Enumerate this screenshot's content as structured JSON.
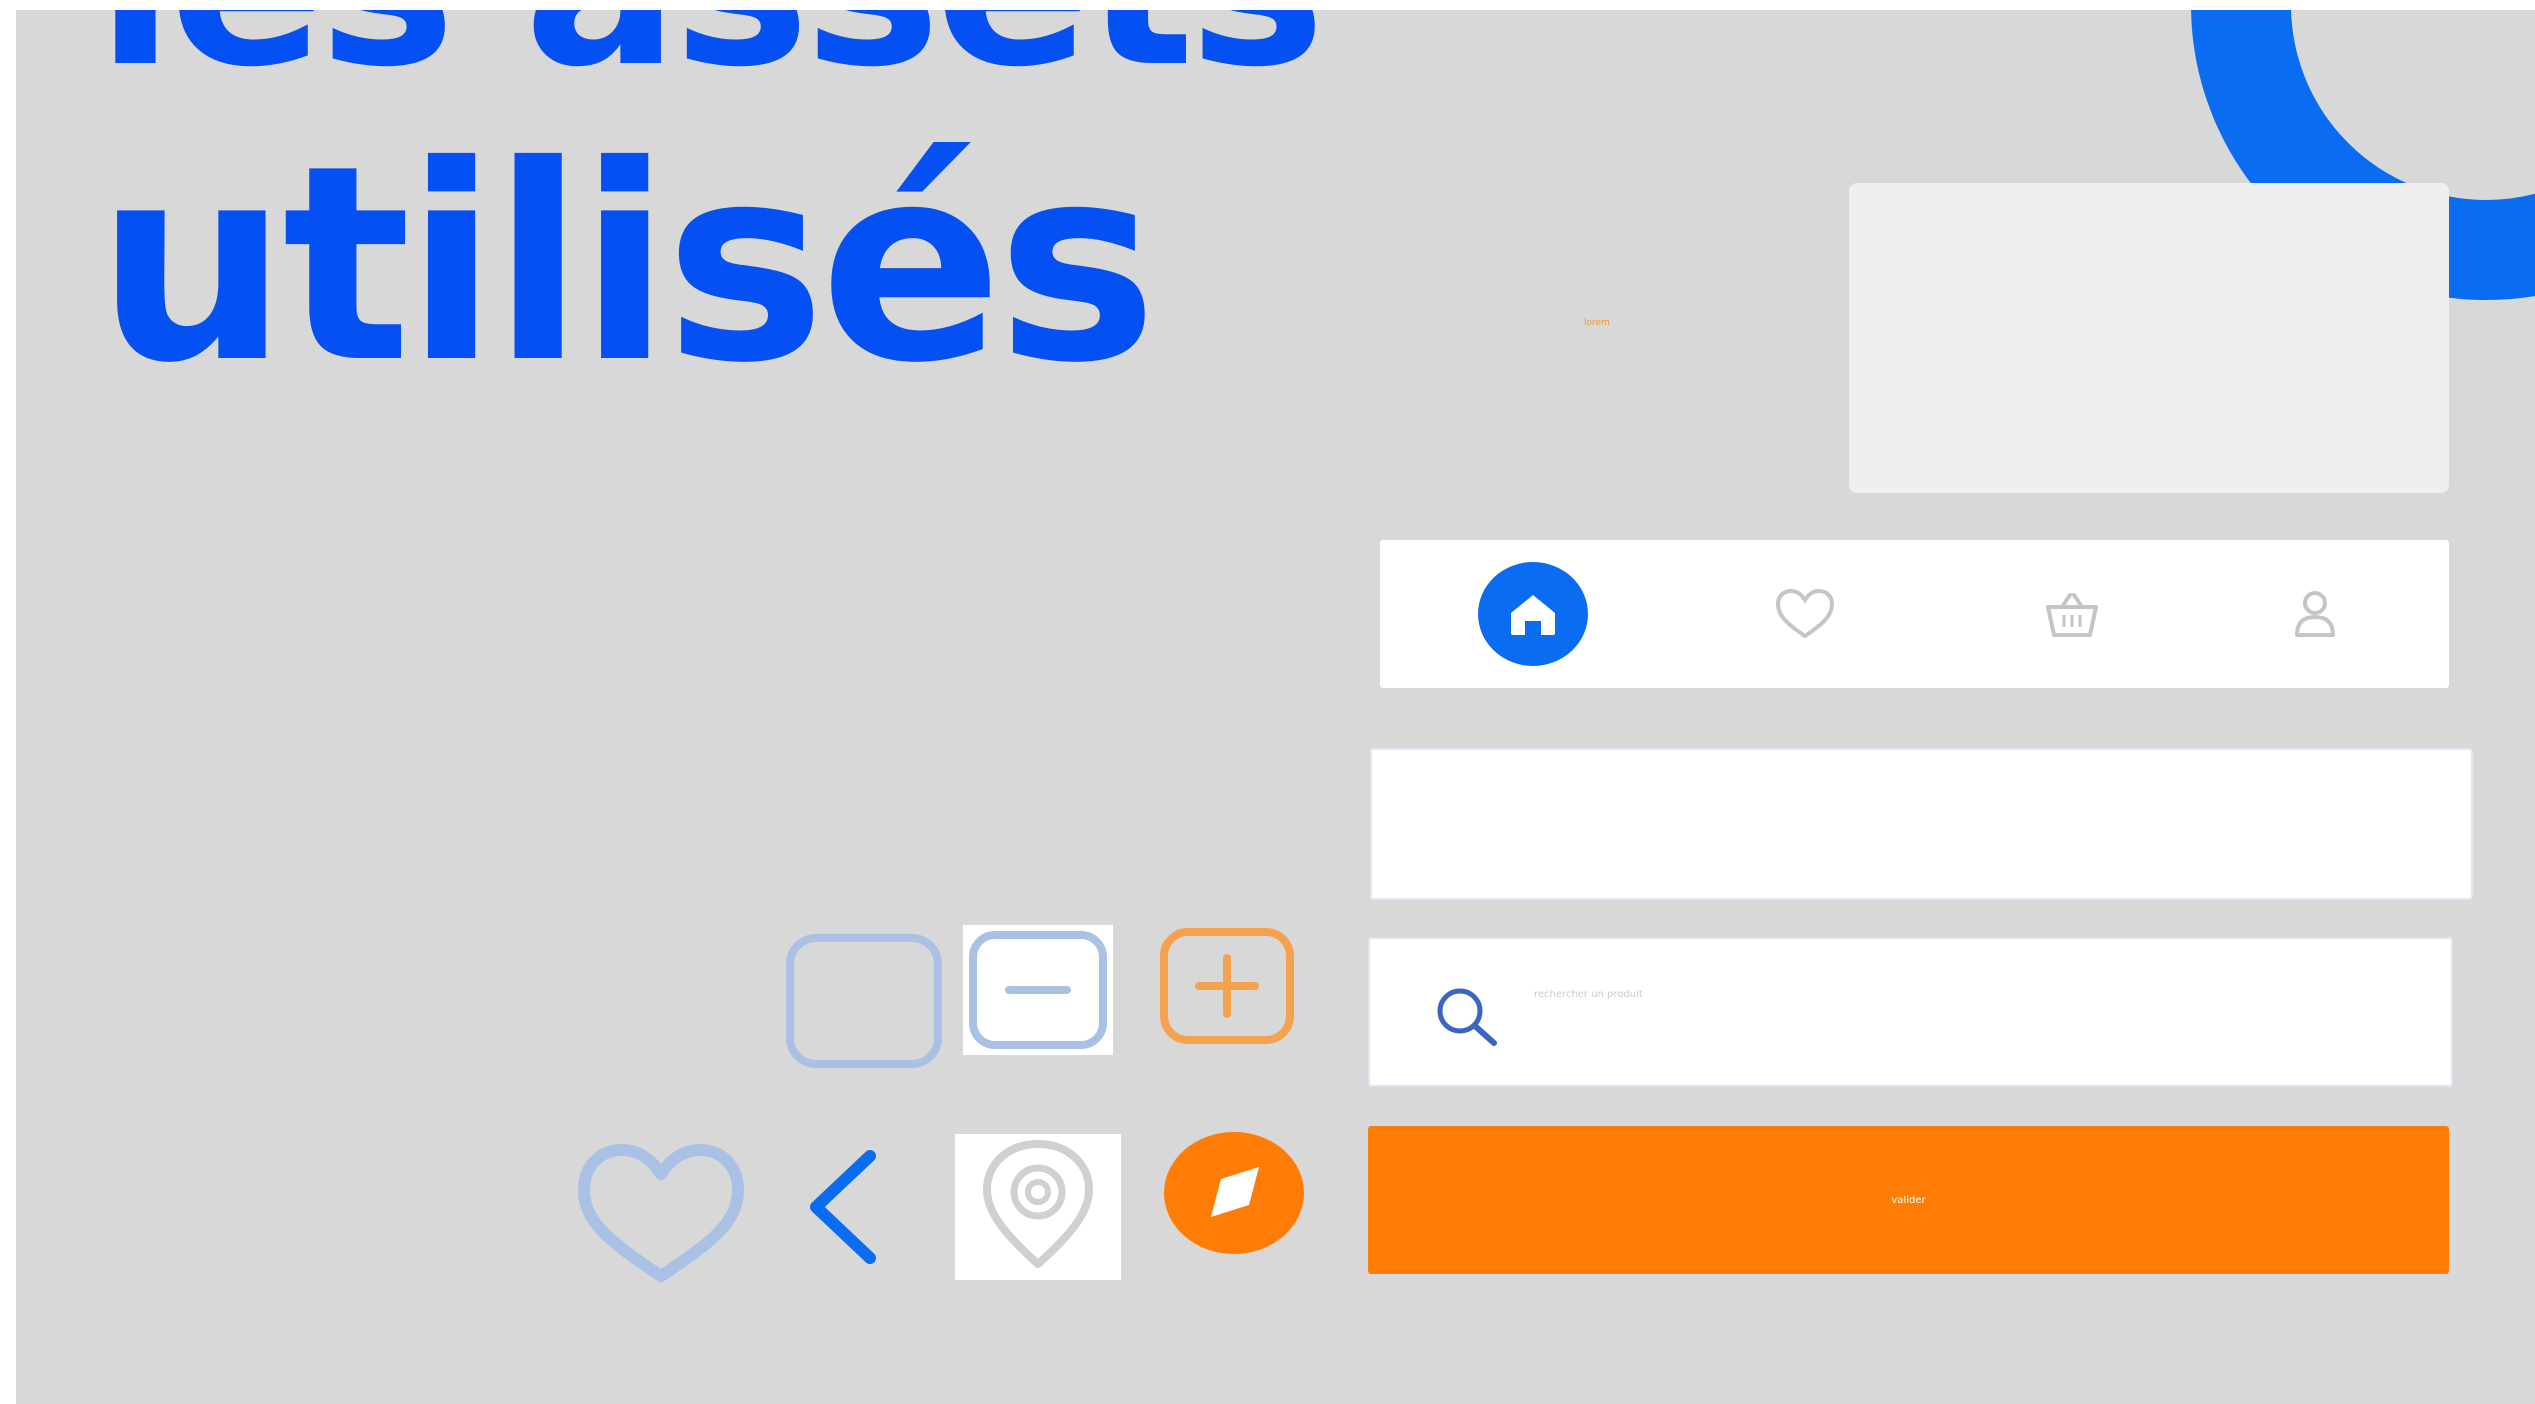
{
  "heading": {
    "line1": "les assets",
    "line2": "utilisés"
  },
  "card": {
    "tiny_label": "lorem"
  },
  "bottom_nav": {
    "items": [
      {
        "icon": "home-icon",
        "active": true
      },
      {
        "icon": "heart-icon",
        "active": false
      },
      {
        "icon": "basket-icon",
        "active": false
      },
      {
        "icon": "user-icon",
        "active": false
      }
    ]
  },
  "text_field": {
    "placeholder": ""
  },
  "search": {
    "placeholder": "rechercher un produit"
  },
  "primary_button": {
    "label": "valider"
  },
  "colors": {
    "brand_blue": "#0450f2",
    "accent_blue": "#0a6cf0",
    "accent_orange": "#ff7c07",
    "panel_grey": "#d8d8d8",
    "muted_blue": "#a9c1e4"
  },
  "icons": [
    "checkbox-icon",
    "minus-icon",
    "plus-icon",
    "heart-icon",
    "chevron-left-icon",
    "location-pin-icon",
    "compass-icon",
    "search-icon"
  ]
}
